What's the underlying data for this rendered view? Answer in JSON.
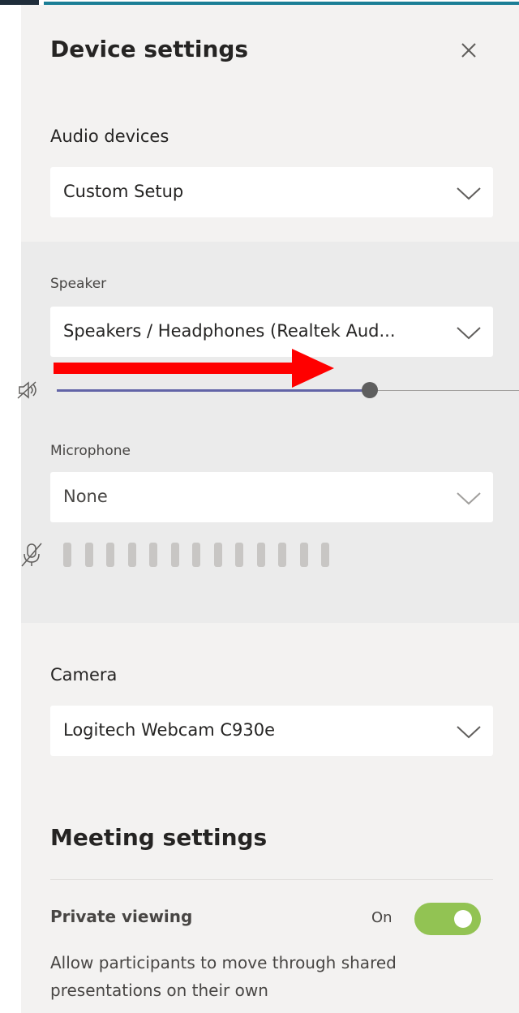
{
  "panel": {
    "title": "Device settings",
    "close_icon": "close-icon"
  },
  "audio": {
    "label": "Audio devices",
    "selected": "Custom Setup",
    "speaker": {
      "label": "Speaker",
      "selected": "Speakers / Headphones (Realtek Aud...",
      "volume_fraction": 0.65,
      "mute_icon": "speaker-muted-icon"
    },
    "microphone": {
      "label": "Microphone",
      "selected": "None",
      "mute_icon": "mic-muted-icon",
      "level_bar_count": 13,
      "level_bars_active": 0
    }
  },
  "camera": {
    "label": "Camera",
    "selected": "Logitech Webcam C930e"
  },
  "meeting": {
    "title": "Meeting settings",
    "private_viewing": {
      "label": "Private viewing",
      "state_label": "On",
      "enabled": true,
      "description": "Allow participants to move through shared presentations on their own"
    }
  },
  "colors": {
    "slider_fill": "#6264a7",
    "toggle_on": "#92c353",
    "annotation_arrow": "#ff0000",
    "top_accent": "#1b7e96"
  }
}
